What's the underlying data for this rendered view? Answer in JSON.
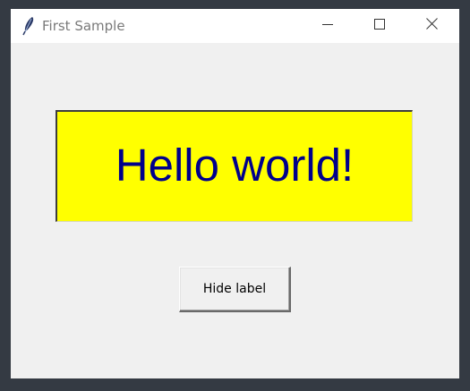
{
  "window": {
    "title": "First Sample",
    "app_icon": "feather-icon",
    "controls": {
      "minimize_icon": "minimize-icon",
      "maximize_icon": "maximize-icon",
      "close_icon": "close-icon"
    }
  },
  "main": {
    "label_text": "Hello world!",
    "label_bg_color": "#ffff00",
    "label_text_color": "#00008b",
    "button_label": "Hide label"
  }
}
